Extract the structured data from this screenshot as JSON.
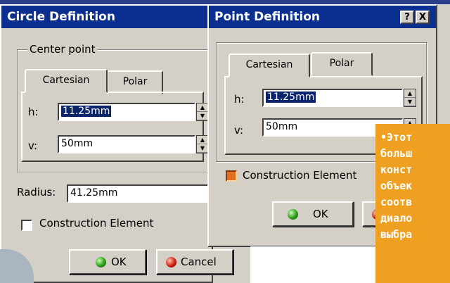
{
  "circle_dialog": {
    "title": "Circle Definition",
    "group_label": "Center point",
    "tabs": [
      "Cartesian",
      "Polar"
    ],
    "h_label": "h:",
    "h_value": "11.25mm",
    "v_label": "v:",
    "v_value": "50mm",
    "radius_label": "Radius:",
    "radius_value": "41.25mm",
    "construction_label": "Construction Element",
    "construction_checked": false,
    "ok_label": "OK",
    "cancel_label": "Cancel"
  },
  "point_dialog": {
    "title": "Point Definition",
    "help_button": "?",
    "close_button": "X",
    "tabs": [
      "Cartesian",
      "Polar"
    ],
    "h_label": "h:",
    "h_value": "11.25mm",
    "v_label": "v:",
    "v_value": "50mm",
    "construction_label": "Construction Element",
    "construction_checked": true,
    "ok_label": "OK"
  },
  "note": {
    "lines": [
      "•Этот",
      "больш",
      "конст",
      "объек",
      "соотв",
      "диало",
      "выбра"
    ]
  },
  "colors": {
    "titlebar": "#0a2f8f",
    "note_background": "#f0a020",
    "selection": "#0a246a",
    "checkbox_checked": "#e07020"
  }
}
